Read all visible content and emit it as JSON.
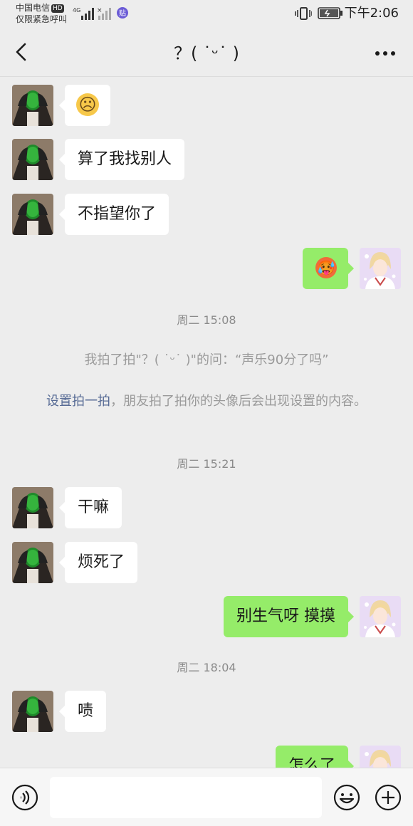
{
  "status_bar": {
    "carrier_line1": "中国电信",
    "hd_badge": "HD",
    "carrier_line2": "仅限紧急呼叫",
    "network": "4G",
    "app_badge": "贴",
    "time": "下午2:06"
  },
  "nav": {
    "title": "？(  ˙ᵕ˙ )"
  },
  "messages": [
    {
      "text": "☹"
    },
    {
      "text": "算了我找别人"
    },
    {
      "text": "不指望你了"
    },
    {
      "text": "🥵"
    }
  ],
  "timestamp_1": "周二 15:08",
  "pat_notice": "我拍了拍\"？(  ˙ᵕ˙ )\"的问：“声乐90分了吗”",
  "pat_setting": {
    "link": "设置拍一拍",
    "text": "，朋友拍了拍你的头像后会出现设置的内容。"
  },
  "timestamp_2": "周二 15:21",
  "messages_2": [
    {
      "text": "干嘛"
    },
    {
      "text": "烦死了"
    },
    {
      "text": "别生气呀 摸摸"
    }
  ],
  "timestamp_3": "周二 18:04",
  "messages_3": [
    {
      "text": "啧"
    },
    {
      "text": "怎么了"
    }
  ],
  "input": {
    "placeholder": "",
    "value": ""
  },
  "colors": {
    "background": "#ededed",
    "sent_bubble": "#95ec69",
    "received_bubble": "#ffffff",
    "link": "#576b95"
  }
}
